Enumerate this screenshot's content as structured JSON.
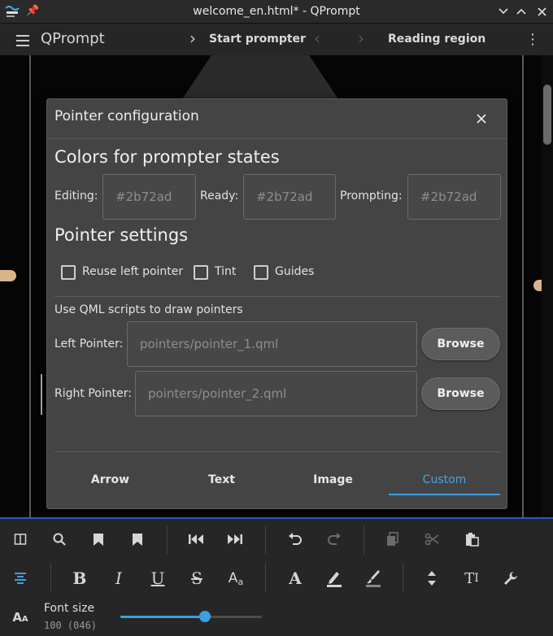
{
  "window": {
    "title": "welcome_en.html* - QPrompt"
  },
  "appbar": {
    "app_name": "QPrompt",
    "start_label": "Start prompter",
    "reading_label": "Reading region"
  },
  "dialog": {
    "title": "Pointer configuration",
    "colors_heading": "Colors for prompter states",
    "editing_label": "Editing:",
    "editing_value": "#2b72ad",
    "ready_label": "Ready:",
    "ready_value": "#2b72ad",
    "prompting_label": "Prompting:",
    "prompting_value": "#2b72ad",
    "pointer_heading": "Pointer settings",
    "reuse_label": "Reuse left pointer",
    "tint_label": "Tint",
    "guides_label": "Guides",
    "qml_note": "Use QML scripts to draw pointers",
    "left_label": "Left Pointer:",
    "left_value": "pointers/pointer_1.qml",
    "right_label": "Right Pointer:",
    "right_value": "pointers/pointer_2.qml",
    "browse_label": "Browse",
    "tabs": [
      "Arrow",
      "Text",
      "Image",
      "Custom"
    ],
    "active_tab": "Custom"
  },
  "toolbar": {
    "font_size_label": "Font size",
    "font_size_value": "100 (046)",
    "font_size_fraction": 0.6
  },
  "colors": {
    "accent": "#3d9ee0",
    "dialog_bg": "#444444"
  }
}
